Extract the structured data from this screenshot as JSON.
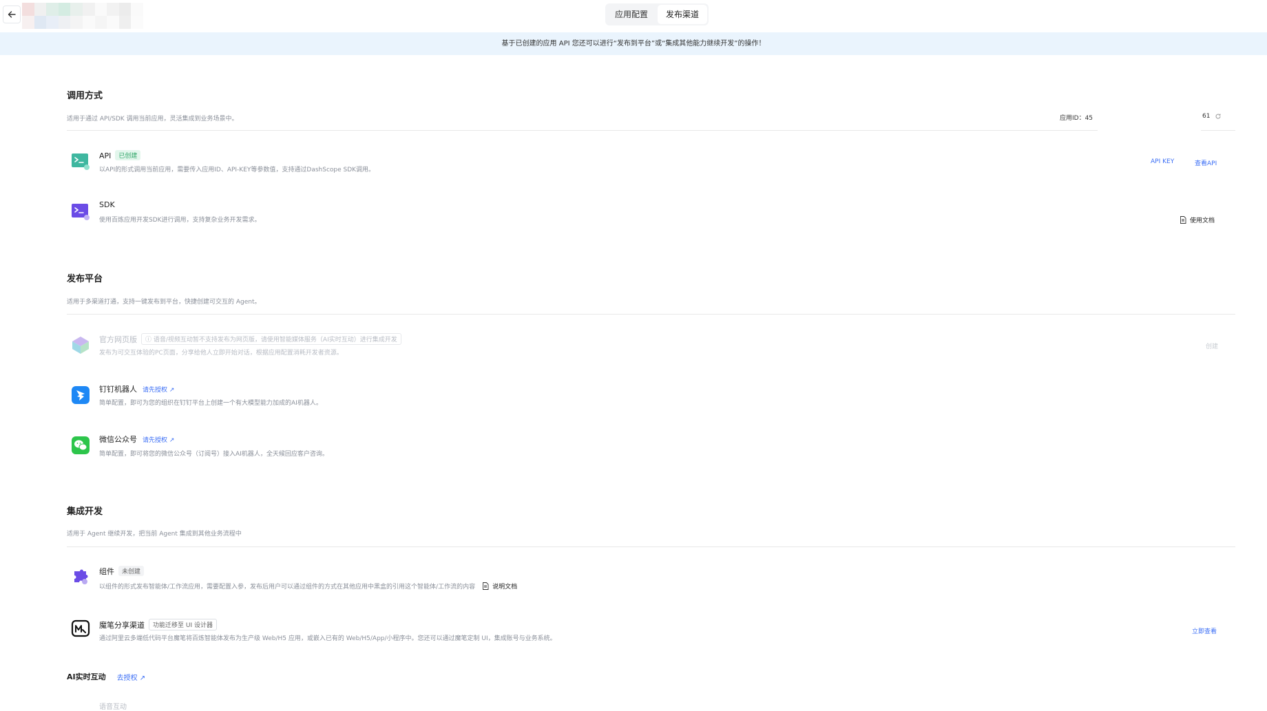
{
  "header": {
    "back_icon": "arrow-left-icon",
    "tabs": [
      {
        "label": "应用配置",
        "active": false
      },
      {
        "label": "发布渠道",
        "active": true
      }
    ]
  },
  "banner": {
    "text": "基于已创建的应用 API 您还可以进行“发布到平台”或“集成其他能力继续开发”的操作！"
  },
  "invoke": {
    "title": "调用方式",
    "desc": "适用于通过 API/SDK 调用当前应用，灵活集成到业务场景中。",
    "app_id_label": "应用ID：45",
    "app_id_suffix": "61",
    "items": [
      {
        "icon": "terminal-icon",
        "title": "API",
        "badge": "已创建",
        "desc": "以API的形式调用当前应用，需要传入应用ID、API-KEY等参数值，支持通过DashScope SDK调用。",
        "actions": [
          "API KEY",
          "查看API"
        ]
      },
      {
        "icon": "terminal-icon",
        "title": "SDK",
        "desc": "使用百炼应用开发SDK进行调用，支持复杂业务开发需求。",
        "actions": [
          "使用文档"
        ]
      }
    ]
  },
  "publish": {
    "title": "发布平台",
    "desc": "适用于多渠道打通，支持一键发布到平台，快捷创建可交互的 Agent。",
    "items": [
      {
        "icon": "web-cube-icon",
        "title": "官方网页版",
        "notice": "语音/视频互动暂不支持发布为网页版，请使用智能媒体服务（AI实时互动）进行集成开发",
        "desc": "发布为可交互体验的PC页面，分享给他人立即开始对话，根据应用配置消耗开发者资源。",
        "action": "创建"
      },
      {
        "icon": "dingtalk-icon",
        "title": "钉钉机器人",
        "link": "请先授权",
        "desc": "简单配置，即可为您的组织在钉钉平台上创建一个有大模型能力加成的AI机器人。"
      },
      {
        "icon": "wechat-icon",
        "title": "微信公众号",
        "link": "请先授权",
        "desc": "简单配置，即可将您的微信公众号（订阅号）接入AI机器人，全天候回应客户咨询。"
      }
    ]
  },
  "integrate": {
    "title": "集成开发",
    "desc": "适用于 Agent 继续开发，把当前 Agent 集成到其他业务流程中",
    "items": [
      {
        "icon": "puzzle-icon",
        "title": "组件",
        "badge": "未创建",
        "desc": "以组件的形式发布智能体/工作流应用，需要配置入参，发布后用户可以通过组件的方式在其他应用中黑盒的引用这个智能体/工作流的内容",
        "doc_link": "说明文档"
      },
      {
        "icon": "mobi-icon",
        "title": "魔笔分享渠道",
        "badge": "功能迁移至 UI 设计器",
        "desc": "通过阿里云多端低代码平台魔笔将百炼智能体发布为生产级 Web/H5 应用，或嵌入已有的 Web/H5/App/小程序中。您还可以通过魔笔定制 UI，集成账号与业务系统。",
        "action": "立即查看"
      }
    ]
  },
  "realtime": {
    "title": "AI实时互动",
    "link": "去授权",
    "item": "语音互动"
  },
  "colors": {
    "accent": "#3b6ef5",
    "banner_bg": "#eaf4fd",
    "badge_green": "#2ea567"
  }
}
